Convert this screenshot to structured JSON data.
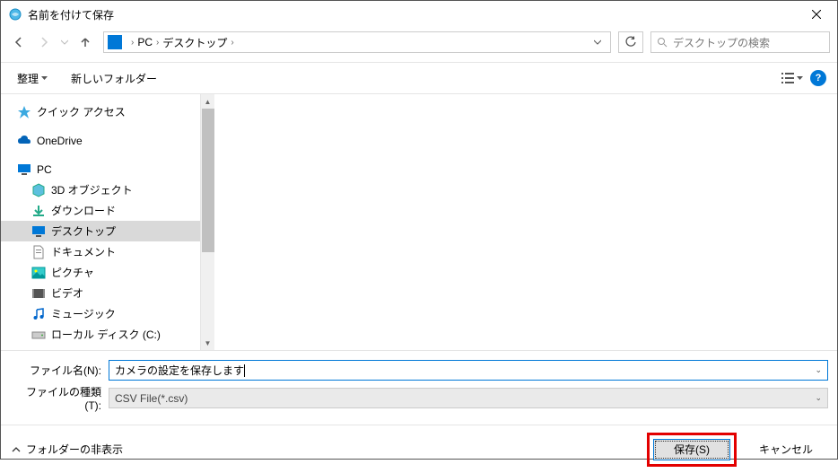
{
  "titlebar": {
    "title": "名前を付けて保存"
  },
  "breadcrumb": {
    "item1": "PC",
    "item2": "デスクトップ"
  },
  "search": {
    "placeholder": "デスクトップの検索"
  },
  "toolbar": {
    "organize": "整理",
    "newfolder": "新しいフォルダー"
  },
  "tree": {
    "quickaccess": "クイック アクセス",
    "onedrive": "OneDrive",
    "pc": "PC",
    "objects3d": "3D オブジェクト",
    "downloads": "ダウンロード",
    "desktop": "デスクトップ",
    "documents": "ドキュメント",
    "pictures": "ピクチャ",
    "videos": "ビデオ",
    "music": "ミュージック",
    "localdisk": "ローカル ディスク (C:)"
  },
  "file": {
    "name_label": "ファイル名(N):",
    "name_value": "カメラの設定を保存します",
    "type_label": "ファイルの種類(T):",
    "type_value": "CSV File(*.csv)"
  },
  "footer": {
    "hidefolders": "フォルダーの非表示",
    "save": "保存(S)",
    "cancel": "キャンセル"
  }
}
